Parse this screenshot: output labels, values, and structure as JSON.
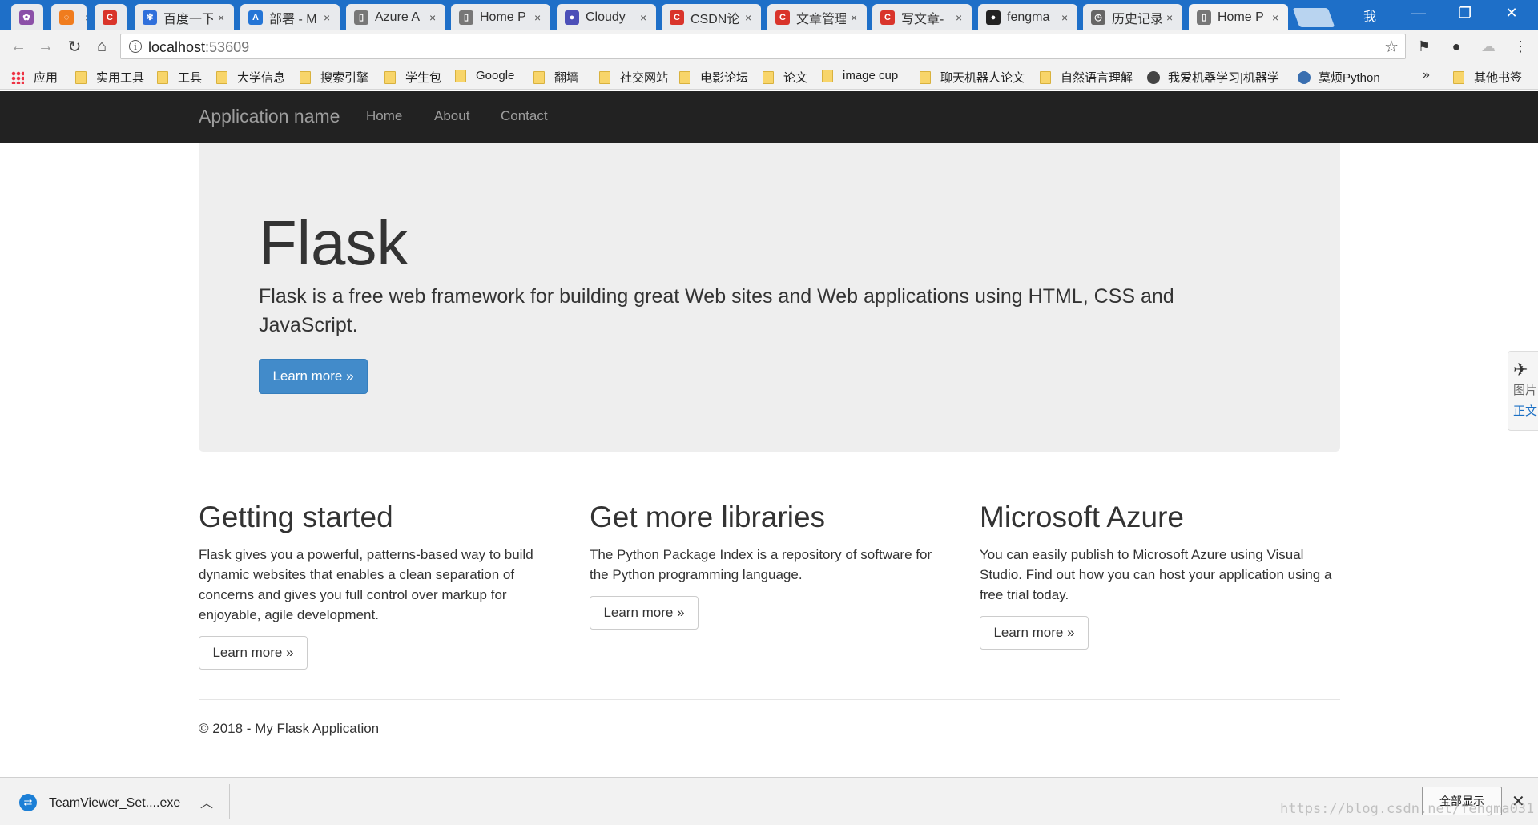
{
  "browser": {
    "tabs": [
      {
        "title": "",
        "icon": "app-icon",
        "color": "#8a4fa8"
      },
      {
        "title": "",
        "icon": "loading-icon",
        "color": "#f07c1e"
      },
      {
        "title": "",
        "icon": "csdn-icon",
        "color": "#d9342b"
      },
      {
        "title": "百度一下",
        "icon": "baidu-icon",
        "color": "#2f6fdb"
      },
      {
        "title": "部署 - M",
        "icon": "azure-icon",
        "color": "#2475d6"
      },
      {
        "title": "Azure A",
        "icon": "page-icon",
        "color": "#777777"
      },
      {
        "title": "Home P",
        "icon": "page-icon",
        "color": "#777777"
      },
      {
        "title": "Cloudy",
        "icon": "cloudy-icon",
        "color": "#4b4fb8"
      },
      {
        "title": "CSDN论",
        "icon": "csdn-icon",
        "color": "#d9342b"
      },
      {
        "title": "文章管理",
        "icon": "csdn-icon",
        "color": "#d9342b"
      },
      {
        "title": "写文章-",
        "icon": "csdn-icon",
        "color": "#d9342b"
      },
      {
        "title": "fengma",
        "icon": "github-icon",
        "color": "#222222"
      },
      {
        "title": "历史记录",
        "icon": "history-icon",
        "color": "#666666"
      },
      {
        "title": "Home P",
        "icon": "page-icon",
        "color": "#777777",
        "active": true
      }
    ],
    "profile_label": "我",
    "url_host": "localhost",
    "url_port": ":53609",
    "bookmarks": [
      {
        "label": "应用",
        "kind": "apps"
      },
      {
        "label": "实用工具",
        "kind": "folder"
      },
      {
        "label": "工具",
        "kind": "folder"
      },
      {
        "label": "大学信息",
        "kind": "folder"
      },
      {
        "label": "搜索引擎",
        "kind": "folder"
      },
      {
        "label": "学生包",
        "kind": "folder"
      },
      {
        "label": "Google",
        "kind": "folder"
      },
      {
        "label": "翻墙",
        "kind": "folder"
      },
      {
        "label": "社交网站",
        "kind": "folder"
      },
      {
        "label": "电影论坛",
        "kind": "folder"
      },
      {
        "label": "论文",
        "kind": "folder"
      },
      {
        "label": "image cup",
        "kind": "folder"
      },
      {
        "label": "聊天机器人论文",
        "kind": "folder"
      },
      {
        "label": "自然语言理解",
        "kind": "folder"
      },
      {
        "label": "我爱机器学习|机器学",
        "kind": "site"
      },
      {
        "label": "莫烦Python",
        "kind": "site"
      },
      {
        "label": "其他书签",
        "kind": "folder"
      }
    ],
    "bookmarks_more": "»"
  },
  "site": {
    "brand": "Application name",
    "nav": [
      "Home",
      "About",
      "Contact"
    ],
    "jumbotron": {
      "title": "Flask",
      "lead": "Flask is a free web framework for building great Web sites and Web applications using HTML, CSS and JavaScript.",
      "button": "Learn more »"
    },
    "columns": [
      {
        "title": "Getting started",
        "text": "Flask gives you a powerful, patterns-based way to build dynamic websites that enables a clean separation of concerns and gives you full control over markup for enjoyable, agile development.",
        "button": "Learn more »"
      },
      {
        "title": "Get more libraries",
        "text": "The Python Package Index is a repository of software for the Python programming language.",
        "button": "Learn more »"
      },
      {
        "title": "Microsoft Azure",
        "text": "You can easily publish to Microsoft Azure using Visual Studio. Find out how you can host your application using a free trial today.",
        "button": "Learn more »"
      }
    ],
    "footer": "© 2018 - My Flask Application"
  },
  "side_widget": {
    "line1": "图片",
    "line2": "正文"
  },
  "downloads": {
    "file_name": "TeamViewer_Set....exe",
    "show_all": "全部显示"
  },
  "watermark": "https://blog.csdn.net/fengma031",
  "colors": {
    "navbar": "#222222",
    "primary": "#428bca",
    "jumbotron": "#eeeeee",
    "tabstrip": "#1e6fc8"
  }
}
